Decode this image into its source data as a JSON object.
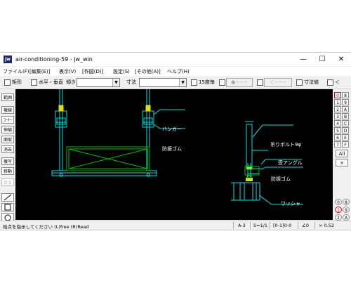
{
  "window": {
    "icon_text": "jw",
    "title": "air-conditioning-59 - jw_win",
    "controls": [
      "—",
      "☐",
      "✕"
    ]
  },
  "menubar": [
    "ファイル(F)",
    "[編集(E)]",
    "表示(V)",
    "[作図(D)]",
    "設定(S)",
    "[その他(A)]",
    "ヘルプ(H)"
  ],
  "toolbar": {
    "rect_label": "矩形",
    "horiz_vert_label": "水平・垂直",
    "angle_label": "傾き",
    "dim_label": "寸法",
    "deg15_label": "15度毎",
    "point_btn": "●−−−",
    "arrow_btn": "＜−−−",
    "dim_value_label": "寸法値",
    "lt_label": "＜"
  },
  "left_tools": [
    "範囲",
    "複線",
    "ｺｰﾅｰ",
    "伸縮",
    "面取",
    "消去",
    "複写",
    "移動",
    "戻る"
  ],
  "right_tools": [
    "0",
    "8",
    "1",
    "9",
    "2",
    "A",
    "3",
    "B",
    "4",
    "C",
    "5",
    "D",
    "6",
    "E",
    "7",
    "F"
  ],
  "right_extra": [
    "All",
    "×"
  ],
  "layer_group": [
    "0",
    "8",
    "1",
    "9",
    "2",
    "A"
  ],
  "drawing_labels": {
    "hanger": "ハンガー",
    "rubber_left": "防振ゴム",
    "bolt": "吊りボルト9φ",
    "angle": "受アングル",
    "rubber_right": "防振ゴム",
    "washer": "ワッシャ"
  },
  "statusbar": {
    "message": "始点を指示してください (L)free (R)Read",
    "paper": "A-3",
    "scale": "S=1/1",
    "layer": "[0-1]0-0",
    "angle": "∠0",
    "zoom": "× 0.52"
  },
  "colors": {
    "canvas": "#000000",
    "cyan": "#00e0e0",
    "green": "#00c000",
    "yellow": "#e0e000"
  }
}
